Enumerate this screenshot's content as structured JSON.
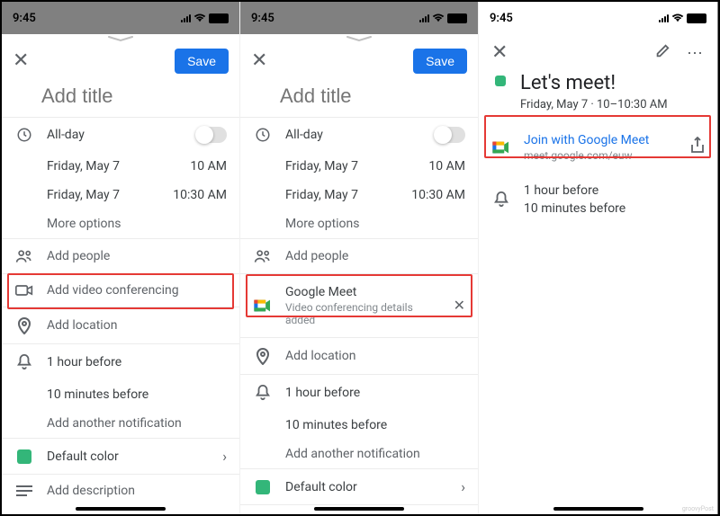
{
  "status": {
    "time": "9:45"
  },
  "common": {
    "save_label": "Save",
    "title_placeholder": "Add title",
    "allday": "All-day",
    "date": "Friday, May 7",
    "start": "10 AM",
    "end": "10:30 AM",
    "more_options": "More options",
    "add_people": "Add people",
    "add_location": "Add location",
    "notif_1": "1 hour before",
    "notif_2": "10 minutes before",
    "add_another_notif": "Add another notification",
    "default_color": "Default color",
    "add_description": "Add description"
  },
  "s1": {
    "video_row": "Add video conferencing"
  },
  "s2": {
    "meet_label": "Google Meet",
    "meet_sub": "Video conferencing details added"
  },
  "s3": {
    "title": "Let's meet!",
    "subtitle": "Friday, May 7 · 10–10:30 AM",
    "join_label": "Join with Google Meet",
    "meet_url": "meet.google.com/euw",
    "notif_1": "1 hour before",
    "notif_2": "10 minutes before"
  }
}
